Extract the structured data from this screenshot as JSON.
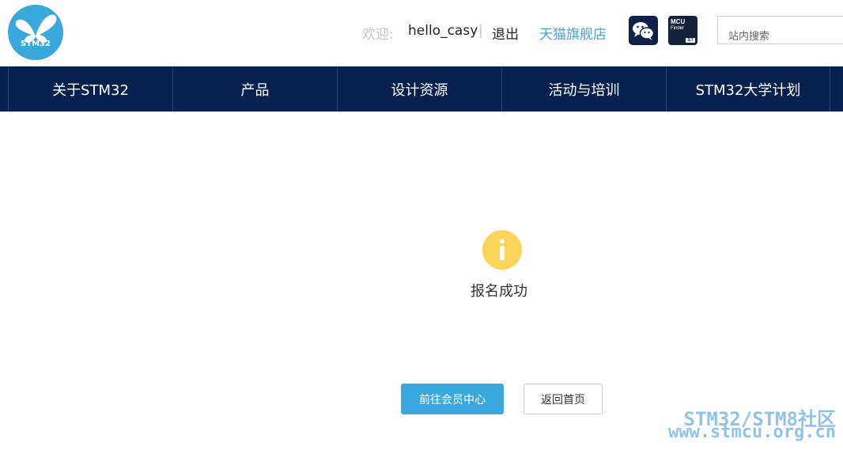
{
  "header": {
    "logo_text": "STM32",
    "welcome_label": "欢迎:",
    "username": "hello_casy",
    "separator": "|",
    "logout_link": "退出",
    "tmall_link": "天猫旗舰店",
    "wechat_icon": "wechat-icon",
    "mcu_finder": {
      "line1": "MCU",
      "line2": "Finder",
      "brand": "ST"
    },
    "search": {
      "placeholder": "站内搜索",
      "value": ""
    }
  },
  "nav": {
    "items": [
      {
        "label": "关于STM32"
      },
      {
        "label": "产品"
      },
      {
        "label": "设计资源"
      },
      {
        "label": "活动与培训"
      },
      {
        "label": "STM32大学计划"
      }
    ]
  },
  "main": {
    "status_icon": "info-icon",
    "message": "报名成功",
    "primary_button": "前往会员中心",
    "secondary_button": "返回首页"
  },
  "watermark": {
    "line1": "STM32/STM8社区",
    "line2": "www.stmcu.org.cn"
  },
  "colors": {
    "nav_bg": "#06204f",
    "accent": "#3aa8df",
    "info_icon": "#fdd45a",
    "logo_bg": "#39a9dc"
  }
}
